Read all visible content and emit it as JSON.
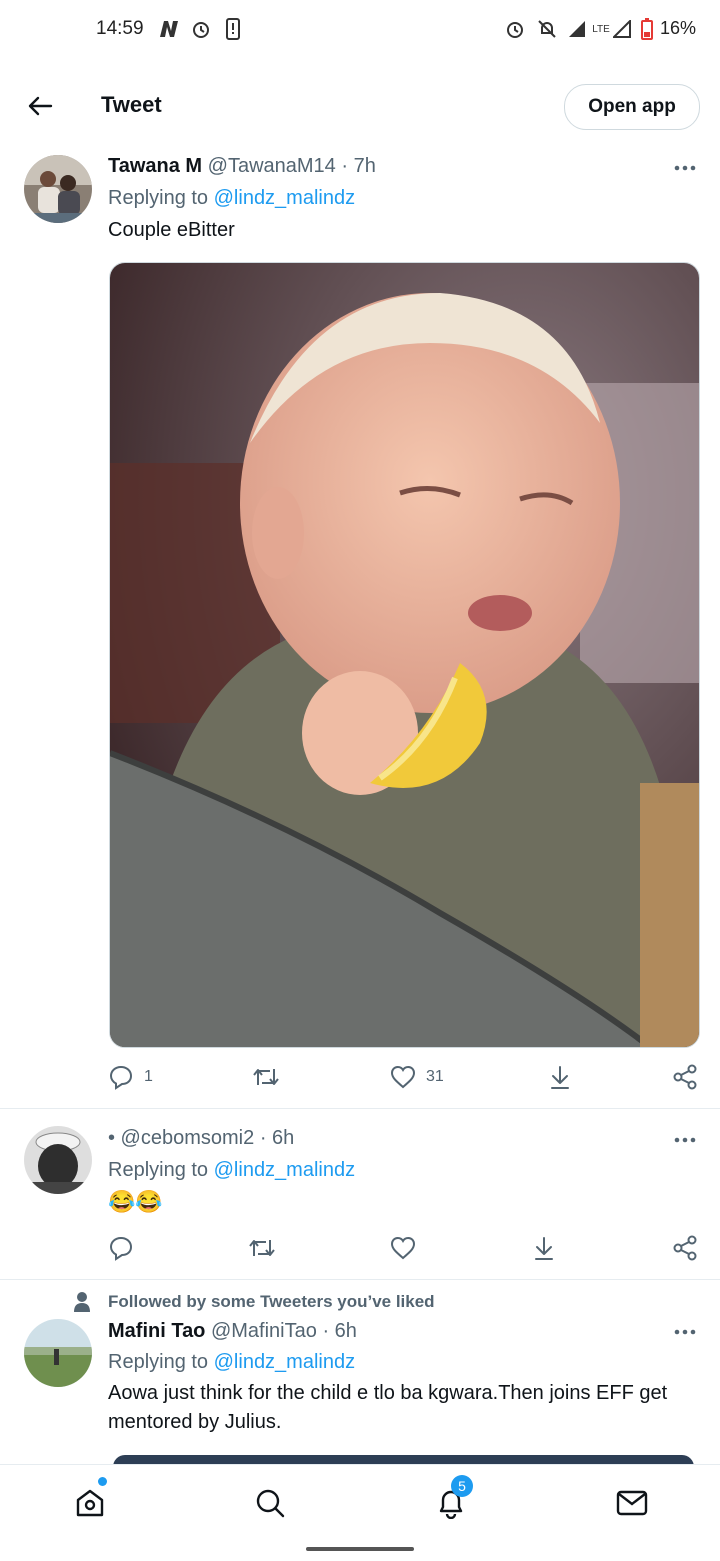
{
  "status_bar": {
    "time": "14:59",
    "battery": "16%",
    "network": "LTE"
  },
  "header": {
    "title": "Tweet",
    "open_app_label": "Open app"
  },
  "tweets": [
    {
      "name": "Tawana M",
      "handle": "@TawanaM14",
      "time": "· 7h",
      "replying_prefix": "Replying to ",
      "replying_to": "@lindz_malindz",
      "text": "Couple eBitter",
      "replies": "1",
      "retweets": "",
      "likes": "31"
    },
    {
      "name": "",
      "handle": "• @cebomsomi2",
      "time": "· 6h",
      "replying_prefix": "Replying to ",
      "replying_to": "@lindz_malindz",
      "text": "😂😂",
      "replies": "",
      "retweets": "",
      "likes": ""
    },
    {
      "social_context": "Followed by some Tweeters you’ve liked",
      "name": "Mafini Tao",
      "handle": "@MafiniTao",
      "time": "· 6h",
      "replying_prefix": "Replying to ",
      "replying_to": "@lindz_malindz",
      "text": "Aowa just think for the child e tlo ba kgwara.Then joins EFF get mentored by Julius."
    }
  ],
  "bottom_nav": {
    "notifications_badge": "5"
  },
  "colors": {
    "accent": "#1d9bf0",
    "muted": "#536471",
    "text": "#0f1419"
  }
}
